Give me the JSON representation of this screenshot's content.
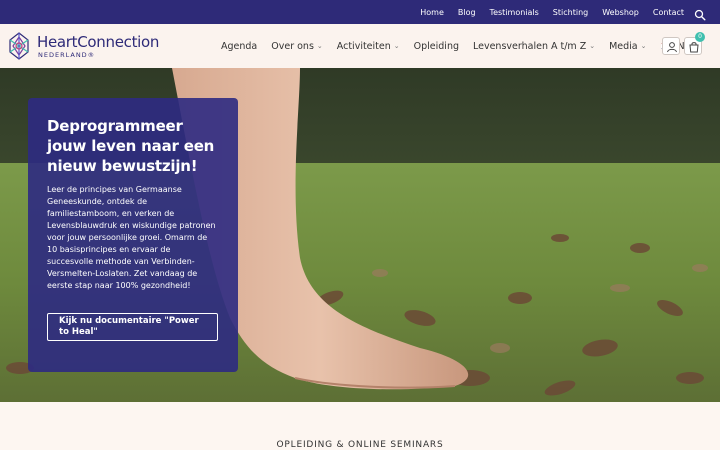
{
  "topbar": {
    "links": [
      "Home",
      "Blog",
      "Testimonials",
      "Stichting",
      "Webshop",
      "Contact"
    ],
    "search_icon": "search-icon"
  },
  "header": {
    "logo_name": "HeartConnection",
    "logo_sub": "NEDERLAND®",
    "nav": [
      {
        "label": "Agenda",
        "dropdown": false
      },
      {
        "label": "Over ons",
        "dropdown": true
      },
      {
        "label": "Activiteiten",
        "dropdown": true
      },
      {
        "label": "Opleiding",
        "dropdown": false
      },
      {
        "label": "Levensverhalen A t/m Z",
        "dropdown": true
      },
      {
        "label": "Media",
        "dropdown": true
      }
    ],
    "language": "NL",
    "cart_count": "0",
    "icons": [
      "user-icon",
      "cart-icon"
    ]
  },
  "hero": {
    "title": "Deprogrammeer jouw leven naar een nieuw bewustzijn!",
    "body": "Leer de principes van Germaanse Geneeskunde, ontdek de familiestamboom, en verken de Levensblauwdruk en wiskundige patronen voor jouw persoonlijke groei. Omarm de 10 basisprincipes en ervaar de succesvolle methode van Verbinden-Versmelten-Loslaten. Zet vandaag de eerste stap naar 100% gezondheid!",
    "cta_label": "Kijk nu documentaire \"Power to Heal\""
  },
  "section": {
    "title": "OPLEIDING & ONLINE SEMINARS"
  },
  "colors": {
    "topbar": "#2e2a78",
    "card": "#2e2a82",
    "accent": "#3fbfae"
  }
}
